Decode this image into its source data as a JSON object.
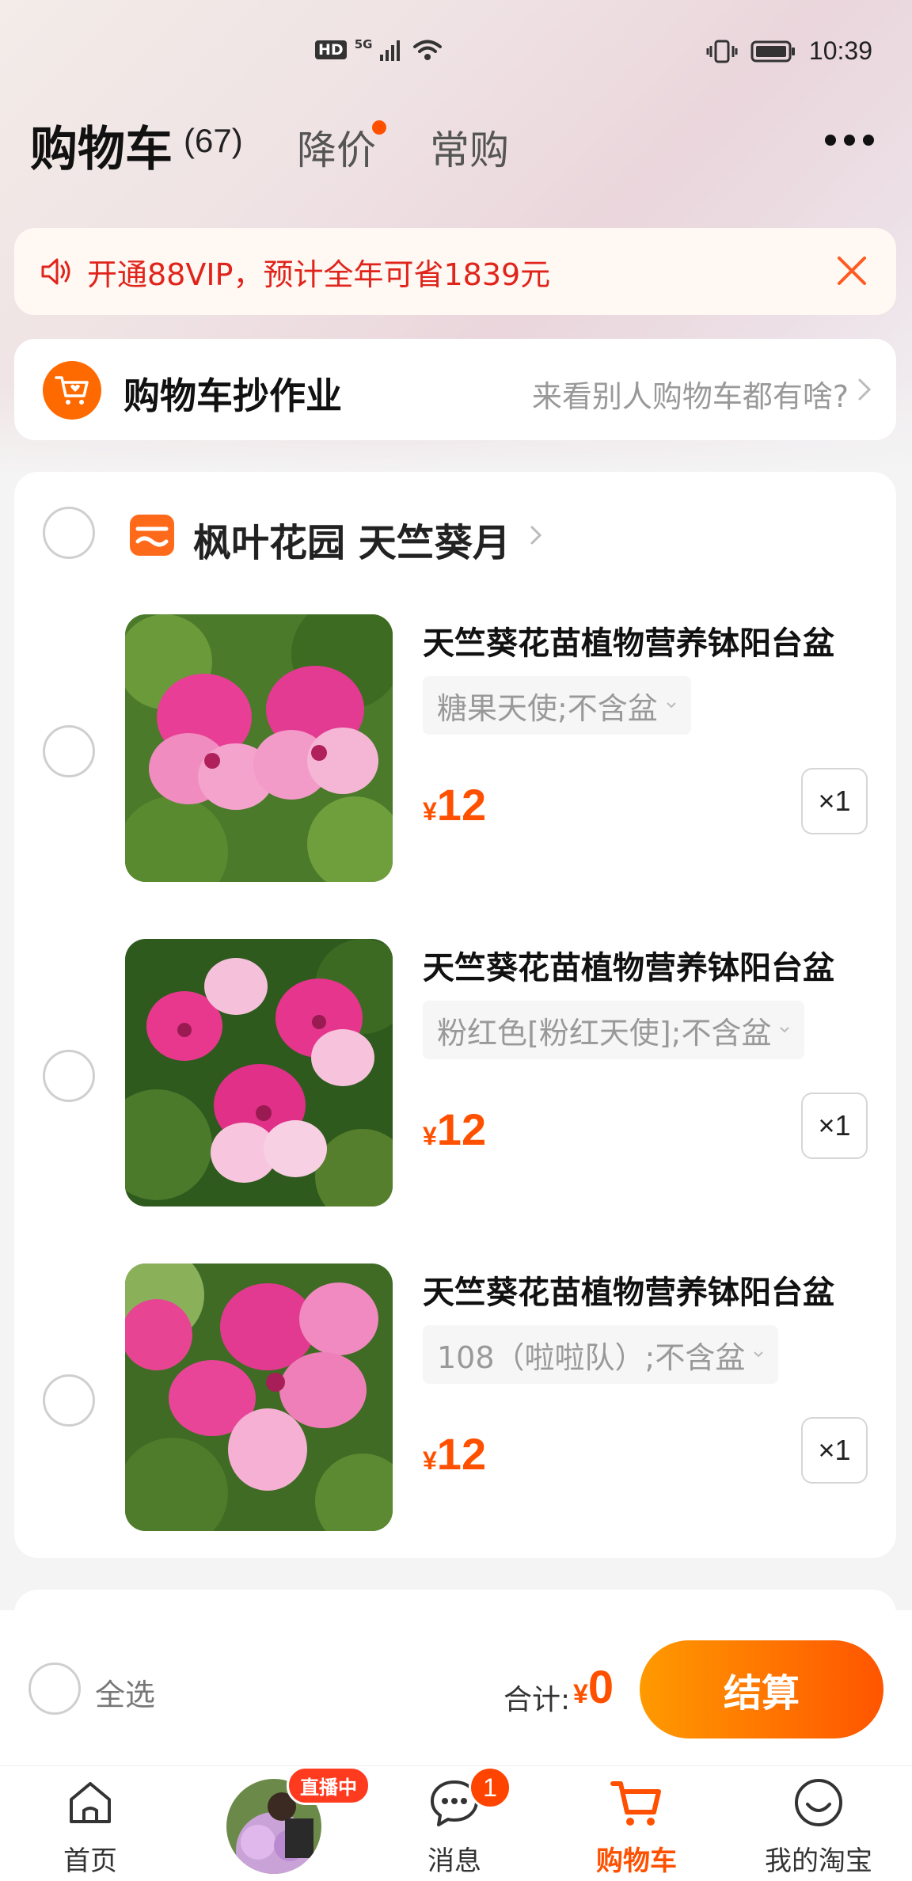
{
  "status_bar": {
    "hd": "HD",
    "network": "5G",
    "time": "10:39"
  },
  "header": {
    "title": "购物车",
    "count": "(67)",
    "tabs": [
      {
        "label": "降价",
        "has_dot": true
      },
      {
        "label": "常购",
        "has_dot": false
      }
    ]
  },
  "vip_banner": {
    "text": "开通88VIP，预计全年可省1839元",
    "icon": "speaker-icon",
    "close_icon": "close-icon"
  },
  "homework": {
    "title": "购物车抄作业",
    "subtitle": "来看别人购物车都有啥?"
  },
  "shop": {
    "name": "枫叶花园 天竺葵月",
    "items": [
      {
        "title": "天竺葵花苗植物营养钵阳台盆",
        "spec": "糖果天使;不含盆",
        "currency": "¥",
        "price": "12",
        "qty": "×1"
      },
      {
        "title": "天竺葵花苗植物营养钵阳台盆",
        "spec": "粉红色[粉红天使];不含盆",
        "currency": "¥",
        "price": "12",
        "qty": "×1"
      },
      {
        "title": "天竺葵花苗植物营养钵阳台盆",
        "spec": "108（啦啦队）;不含盆",
        "currency": "¥",
        "price": "12",
        "qty": "×1"
      }
    ]
  },
  "checkout": {
    "select_all": "全选",
    "total_label": "合计:",
    "currency": "¥",
    "total": "0",
    "button": "结算"
  },
  "tabbar": {
    "home": "首页",
    "live": "直播中",
    "messages": "消息",
    "messages_badge": "1",
    "cart": "购物车",
    "my": "我的淘宝"
  },
  "colors": {
    "accent": "#ff5000",
    "vip_text": "#e0241b"
  }
}
